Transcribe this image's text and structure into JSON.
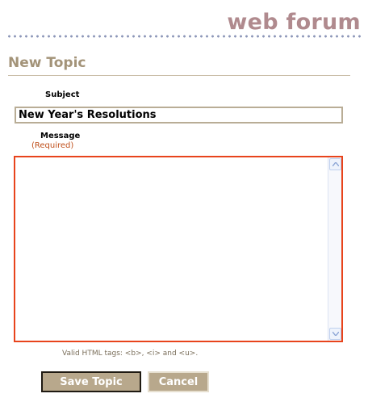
{
  "header": {
    "brand": "web forum"
  },
  "page": {
    "title": "New Topic"
  },
  "form": {
    "subject_label": "Subject",
    "subject_value": "New Year's Resolutions",
    "message_label": "Message",
    "message_required": "(Required)",
    "message_value": "",
    "help_text": "Valid HTML tags: <b>, <i> and <u>."
  },
  "buttons": {
    "save": "Save Topic",
    "cancel": "Cancel"
  },
  "colors": {
    "brand": "#b08a8e",
    "title": "#a39378",
    "required": "#c0501c",
    "message_border": "#e8441c",
    "button": "#b8a88c"
  }
}
